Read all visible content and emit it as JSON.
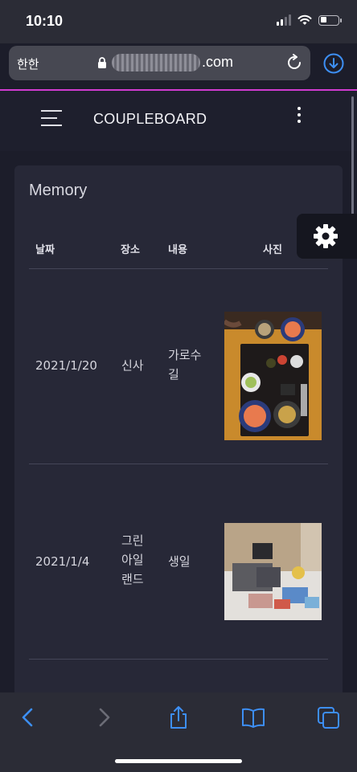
{
  "status_bar": {
    "time": "10:10"
  },
  "browser": {
    "aa_label": "한한",
    "url_suffix": ".com",
    "accent_color": "#d13bd1"
  },
  "app": {
    "brand": "COUPLEBOARD"
  },
  "memory": {
    "title": "Memory",
    "columns": [
      "날짜",
      "장소",
      "내용",
      "사진"
    ],
    "rows": [
      {
        "date": "2021/1/20",
        "place": "신사",
        "content_lines": [
          "가로수",
          "길"
        ],
        "photo": "food-tray-photo"
      },
      {
        "date": "2021/1/4",
        "place_lines": [
          "그린",
          "아일",
          "랜드"
        ],
        "content": "생일",
        "photo": "birthday-gifts-photo"
      }
    ]
  },
  "icons": {
    "settings": "gear-icon",
    "menu": "hamburger-icon",
    "more": "kebab-icon",
    "download": "download-icon",
    "toolbar": [
      "back-icon",
      "forward-icon",
      "share-icon",
      "bookmarks-icon",
      "tabs-icon"
    ]
  },
  "colors": {
    "toolbar_blue": "#3d8ff5",
    "card_bg": "#272837",
    "page_bg": "#1c1d2a"
  }
}
